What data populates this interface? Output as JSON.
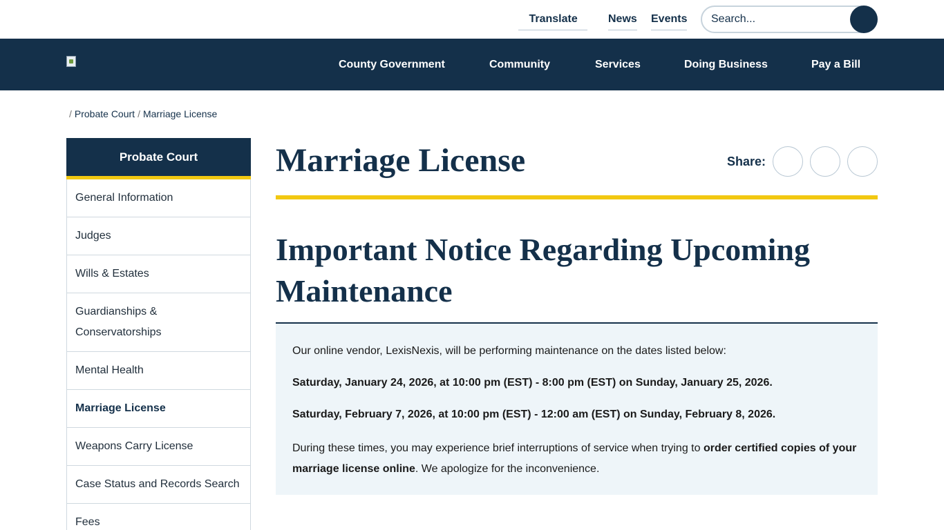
{
  "utility": {
    "translate_label": "Translate",
    "news_label": "News",
    "events_label": "Events",
    "search_placeholder": "Search..."
  },
  "nav": {
    "items": [
      {
        "label": "County Government"
      },
      {
        "label": "Community"
      },
      {
        "label": "Services"
      },
      {
        "label": "Doing Business"
      },
      {
        "label": "Pay a Bill"
      }
    ]
  },
  "breadcrumb": {
    "items": [
      "Probate Court",
      "Marriage License"
    ]
  },
  "sidebar": {
    "heading": "Probate Court",
    "items": [
      {
        "label": "General Information"
      },
      {
        "label": "Judges"
      },
      {
        "label": "Wills & Estates"
      },
      {
        "label": "Guardianships & Conservatorships"
      },
      {
        "label": "Mental Health"
      },
      {
        "label": "Marriage License"
      },
      {
        "label": "Weapons Carry License"
      },
      {
        "label": "Case Status and Records Search"
      },
      {
        "label": "Fees"
      }
    ]
  },
  "page": {
    "title": "Marriage License",
    "share_label": "Share:"
  },
  "notice": {
    "heading": "Important Notice Regarding Upcoming Maintenance",
    "intro": "Our online vendor, LexisNexis, will be performing maintenance on the dates listed below:",
    "date1": "Saturday, January 24, 2026, at 10:00 pm (EST) - 8:00 pm (EST) on Sunday, January 25, 2026.",
    "date2": "Saturday, February 7, 2026, at 10:00 pm (EST) - 12:00 am (EST) on Sunday, February 8, 2026.",
    "outro_start": "During these times, you may experience brief interruptions of service when trying to ",
    "outro_bold": "order certified copies of your marriage license online",
    "outro_end": ". We apologize for the inconvenience."
  },
  "icons": {
    "globe": "globe-icon",
    "chevron": "chevron-down-icon",
    "search": "search-icon",
    "home": "home-icon",
    "share_facebook": "facebook-icon",
    "share_twitter": "twitter-icon",
    "share_email": "email-icon"
  },
  "colors": {
    "navy": "#14304a",
    "accent_yellow": "#f2c811",
    "notice_bg": "#eef5f9"
  }
}
